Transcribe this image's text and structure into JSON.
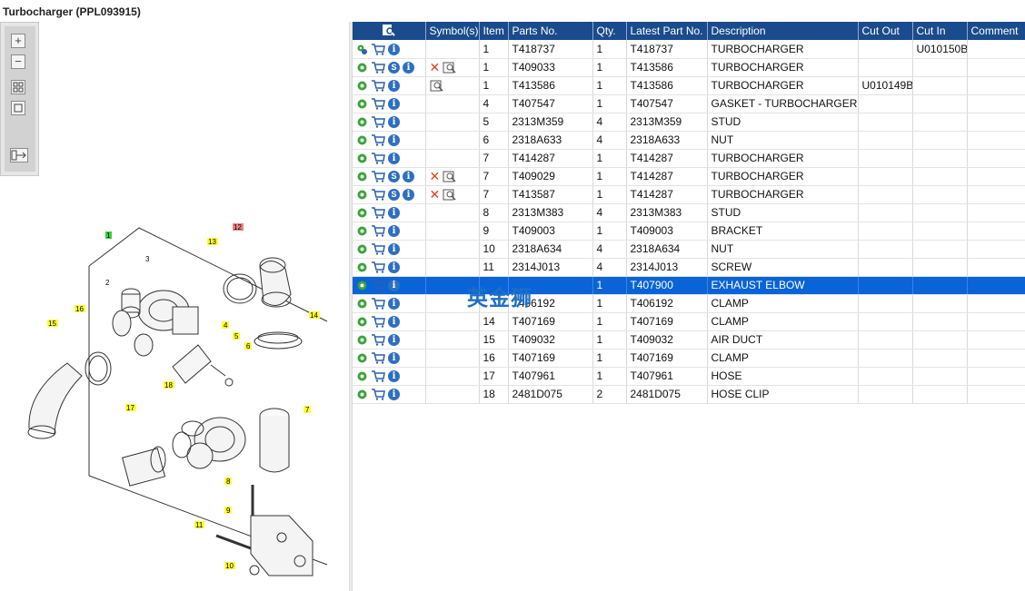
{
  "window": {
    "title": "Turbocharger (PPL093915)"
  },
  "toolbar": {
    "zoom_in_icon": "zoom-in-icon",
    "zoom_out_icon": "zoom-out-icon",
    "fit_icon": "fit-page-icon",
    "one_to_one_icon": "actual-size-icon",
    "export_icon": "export-icon"
  },
  "diagram": {
    "callouts": [
      {
        "label": "1",
        "color": "#36d436"
      },
      {
        "label": "2",
        "color": ""
      },
      {
        "label": "3",
        "color": ""
      },
      {
        "label": "4",
        "color": "#ffff33"
      },
      {
        "label": "5",
        "color": "#ffff33"
      },
      {
        "label": "6",
        "color": "#ffff33"
      },
      {
        "label": "7",
        "color": "#ffff33"
      },
      {
        "label": "8",
        "color": "#ffff33"
      },
      {
        "label": "9",
        "color": "#ffff33"
      },
      {
        "label": "10",
        "color": "#ffff33"
      },
      {
        "label": "11",
        "color": "#ffff33"
      },
      {
        "label": "12",
        "color": "#f08080"
      },
      {
        "label": "13",
        "color": "#ffff33"
      },
      {
        "label": "14",
        "color": "#ffff33"
      },
      {
        "label": "15",
        "color": "#ffff33"
      },
      {
        "label": "16",
        "color": "#ffff33"
      },
      {
        "label": "17",
        "color": "#ffff33"
      },
      {
        "label": "18",
        "color": "#ffff33"
      }
    ]
  },
  "table": {
    "headers": {
      "actions": "",
      "symbols": "Symbol(s)",
      "item": "Item",
      "part_no": "Parts No.",
      "qty": "Qty.",
      "latest": "Latest Part No.",
      "desc": "Description",
      "cut_out": "Cut Out",
      "cut_in": "Cut In",
      "comment": "Comment"
    },
    "rows": [
      {
        "s": false,
        "sym": "",
        "item": "1",
        "part": "T418737",
        "qty": "1",
        "latest": "T418737",
        "desc": "TURBOCHARGER",
        "out": "",
        "in": "U010150B",
        "c": "",
        "sel": false,
        "multi": true
      },
      {
        "s": true,
        "sym": "xbook",
        "item": "1",
        "part": "T409033",
        "qty": "1",
        "latest": "T413586",
        "desc": "TURBOCHARGER",
        "out": "",
        "in": "",
        "c": "",
        "sel": false,
        "multi": false
      },
      {
        "s": false,
        "sym": "book",
        "item": "1",
        "part": "T413586",
        "qty": "1",
        "latest": "T413586",
        "desc": "TURBOCHARGER",
        "out": "U010149B",
        "in": "",
        "c": "",
        "sel": false,
        "multi": false
      },
      {
        "s": false,
        "sym": "",
        "item": "4",
        "part": "T407547",
        "qty": "1",
        "latest": "T407547",
        "desc": "GASKET - TURBOCHARGER",
        "out": "",
        "in": "",
        "c": "",
        "sel": false,
        "multi": false
      },
      {
        "s": false,
        "sym": "",
        "item": "5",
        "part": "2313M359",
        "qty": "4",
        "latest": "2313M359",
        "desc": "STUD",
        "out": "",
        "in": "",
        "c": "",
        "sel": false,
        "multi": false
      },
      {
        "s": false,
        "sym": "",
        "item": "6",
        "part": "2318A633",
        "qty": "4",
        "latest": "2318A633",
        "desc": "NUT",
        "out": "",
        "in": "",
        "c": "",
        "sel": false,
        "multi": false
      },
      {
        "s": false,
        "sym": "",
        "item": "7",
        "part": "T414287",
        "qty": "1",
        "latest": "T414287",
        "desc": "TURBOCHARGER",
        "out": "",
        "in": "",
        "c": "",
        "sel": false,
        "multi": false
      },
      {
        "s": true,
        "sym": "xbook",
        "item": "7",
        "part": "T409029",
        "qty": "1",
        "latest": "T414287",
        "desc": "TURBOCHARGER",
        "out": "",
        "in": "",
        "c": "",
        "sel": false,
        "multi": false
      },
      {
        "s": true,
        "sym": "xbook",
        "item": "7",
        "part": "T413587",
        "qty": "1",
        "latest": "T414287",
        "desc": "TURBOCHARGER",
        "out": "",
        "in": "",
        "c": "",
        "sel": false,
        "multi": false
      },
      {
        "s": false,
        "sym": "",
        "item": "8",
        "part": "2313M383",
        "qty": "4",
        "latest": "2313M383",
        "desc": "STUD",
        "out": "",
        "in": "",
        "c": "",
        "sel": false,
        "multi": false
      },
      {
        "s": false,
        "sym": "",
        "item": "9",
        "part": "T409003",
        "qty": "1",
        "latest": "T409003",
        "desc": "BRACKET",
        "out": "",
        "in": "",
        "c": "",
        "sel": false,
        "multi": false
      },
      {
        "s": false,
        "sym": "",
        "item": "10",
        "part": "2318A634",
        "qty": "4",
        "latest": "2318A634",
        "desc": "NUT",
        "out": "",
        "in": "",
        "c": "",
        "sel": false,
        "multi": false
      },
      {
        "s": false,
        "sym": "",
        "item": "11",
        "part": "2314J013",
        "qty": "4",
        "latest": "2314J013",
        "desc": "SCREW",
        "out": "",
        "in": "",
        "c": "",
        "sel": false,
        "multi": false
      },
      {
        "s": false,
        "sym": "",
        "item": "",
        "part": "",
        "qty": "1",
        "latest": "T407900",
        "desc": "EXHAUST ELBOW",
        "out": "",
        "in": "",
        "c": "",
        "sel": true,
        "multi": false
      },
      {
        "s": false,
        "sym": "",
        "item": "",
        "part": "T406192",
        "qty": "1",
        "latest": "T406192",
        "desc": "CLAMP",
        "out": "",
        "in": "",
        "c": "",
        "sel": false,
        "multi": false
      },
      {
        "s": false,
        "sym": "",
        "item": "14",
        "part": "T407169",
        "qty": "1",
        "latest": "T407169",
        "desc": "CLAMP",
        "out": "",
        "in": "",
        "c": "",
        "sel": false,
        "multi": false
      },
      {
        "s": false,
        "sym": "",
        "item": "15",
        "part": "T409032",
        "qty": "1",
        "latest": "T409032",
        "desc": "AIR DUCT",
        "out": "",
        "in": "",
        "c": "",
        "sel": false,
        "multi": false
      },
      {
        "s": false,
        "sym": "",
        "item": "16",
        "part": "T407169",
        "qty": "1",
        "latest": "T407169",
        "desc": "CLAMP",
        "out": "",
        "in": "",
        "c": "",
        "sel": false,
        "multi": false
      },
      {
        "s": false,
        "sym": "",
        "item": "17",
        "part": "T407961",
        "qty": "1",
        "latest": "T407961",
        "desc": "HOSE",
        "out": "",
        "in": "",
        "c": "",
        "sel": false,
        "multi": false
      },
      {
        "s": false,
        "sym": "",
        "item": "18",
        "part": "2481D075",
        "qty": "2",
        "latest": "2481D075",
        "desc": "HOSE CLIP",
        "out": "",
        "in": "",
        "c": "",
        "sel": false,
        "multi": false
      }
    ]
  },
  "watermark": {
    "text": "英金狮"
  },
  "colors": {
    "header_bg": "#1a4b8c",
    "selection": "#0a64d8",
    "icon_blue": "#2e6fbf",
    "gear_green": "#3aa33a",
    "cart_blue": "#2b5fb0"
  }
}
